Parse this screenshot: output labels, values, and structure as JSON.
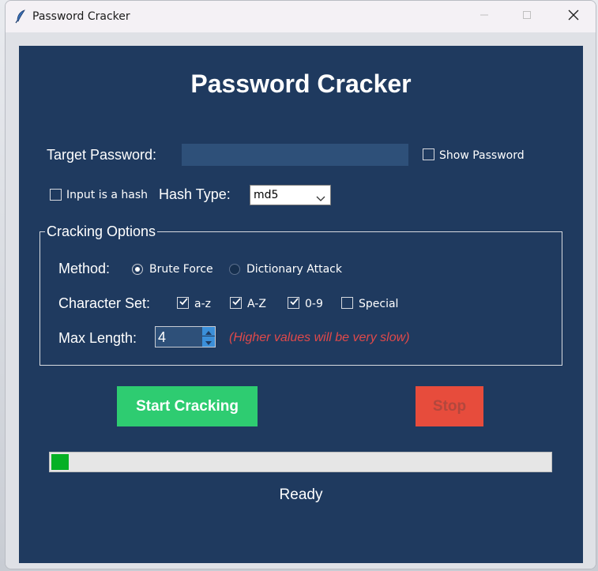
{
  "window": {
    "title": "Password Cracker"
  },
  "app": {
    "heading": "Password Cracker",
    "target_label": "Target Password:",
    "target_value": "",
    "show_password_label": "Show Password",
    "show_password_checked": false,
    "input_hash_label": "Input is a hash",
    "input_hash_checked": false,
    "hash_type_label": "Hash Type:",
    "hash_type_value": "md5",
    "options": {
      "title": "Cracking Options",
      "method_label": "Method:",
      "methods": [
        {
          "label": "Brute Force",
          "selected": true
        },
        {
          "label": "Dictionary Attack",
          "selected": false
        }
      ],
      "charset_label": "Character Set:",
      "charsets": [
        {
          "label": "a-z",
          "checked": true
        },
        {
          "label": "A-Z",
          "checked": true
        },
        {
          "label": "0-9",
          "checked": true
        },
        {
          "label": "Special",
          "checked": false
        }
      ],
      "max_length_label": "Max Length:",
      "max_length_value": "4",
      "warning": "(Higher values will be very slow)"
    },
    "start_label": "Start Cracking",
    "stop_label": "Stop",
    "progress_fraction": 0.035,
    "status": "Ready"
  },
  "colors": {
    "panel": "#1f3a5f",
    "start": "#2ecc71",
    "stop": "#e74c3c",
    "progress": "#06b025",
    "warning": "#e0494a"
  },
  "icons": [
    "feather-icon",
    "minimize-icon",
    "maximize-icon",
    "close-icon",
    "chevron-down-icon",
    "spin-up-icon",
    "spin-down-icon",
    "checkmark-icon"
  ]
}
